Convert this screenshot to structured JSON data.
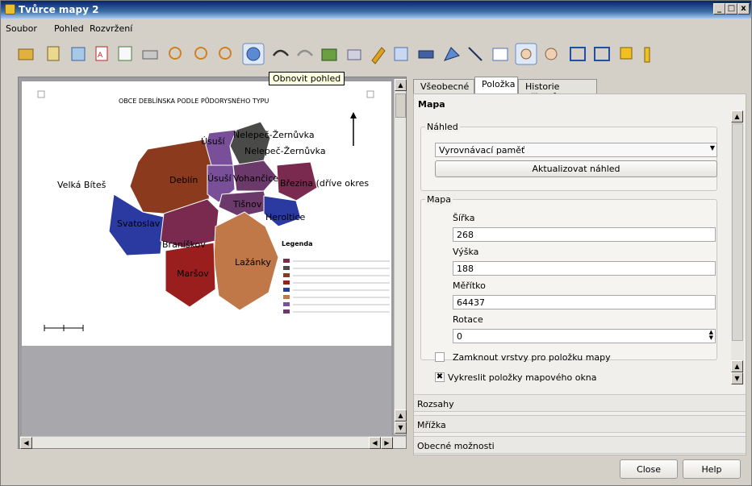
{
  "window": {
    "title": "Tvůrce mapy 2",
    "min_label": "_",
    "max_label": "□",
    "close_label": "x"
  },
  "menu": [
    {
      "label": "Soubor"
    },
    {
      "label": "Pohled"
    },
    {
      "label": "Rozvržení"
    }
  ],
  "toolbar": {
    "icons": [
      "folder-icon",
      "template-icon",
      "export-image-icon",
      "export-pdf-icon",
      "export-svg-icon",
      "print-icon",
      "zoom-full-icon",
      "zoom-in-icon",
      "zoom-out-icon",
      "refresh-view-icon",
      "undo-icon",
      "redo-icon",
      "add-map-icon",
      "add-image-icon",
      "add-label-icon",
      "add-legend-icon",
      "add-scalebar-icon",
      "add-shape-icon",
      "add-arrow-icon",
      "add-table-icon",
      "pan-icon",
      "move-content-icon",
      "group-icon",
      "ungroup-icon",
      "raise-icon",
      "align-icon"
    ],
    "tooltip": "Obnovit pohled"
  },
  "map": {
    "title": "OBCE DEBLÍNSKA PODLE PŮDORYSNÉHO TYPU",
    "regions": [
      {
        "name": "Nelepeč-Žernůvka",
        "color": "#4a4a48"
      },
      {
        "name": "Úsuší",
        "color": "#7a4f9a"
      },
      {
        "name": "Deblín",
        "color": "#8b3a1e"
      },
      {
        "name": "Vohančice",
        "color": "#6b3a6a"
      },
      {
        "name": "Březina (dříve okres",
        "color": "#7a2a4e"
      },
      {
        "name": "Tišnov",
        "color": "#6b3a6a"
      },
      {
        "name": "Heroltice",
        "color": "#2a3aa0"
      },
      {
        "name": "Svatoslav",
        "color": "#2a3aa0"
      },
      {
        "name": "Braníškov",
        "color": "#7a2a4e"
      },
      {
        "name": "Lažánky",
        "color": "#c07848"
      },
      {
        "name": "Maršov",
        "color": "#9a1e1e"
      },
      {
        "name": "Velká Bíteš",
        "color": "#2a3aa0"
      }
    ],
    "legend": {
      "title": "Legenda",
      "items": [
        {
          "color": "#7a2a4e"
        },
        {
          "color": "#4a4a48"
        },
        {
          "color": "#8b3a1e"
        },
        {
          "color": "#9a1e1e"
        },
        {
          "color": "#2a3aa0"
        },
        {
          "color": "#c07848"
        },
        {
          "color": "#7a4f9a"
        },
        {
          "color": "#6b3a6a"
        }
      ]
    }
  },
  "tabs": [
    {
      "label": "Všeobecné"
    },
    {
      "label": "Položka"
    },
    {
      "label": "Historie příkazů"
    }
  ],
  "panel": {
    "section_title": "Mapa",
    "preview": {
      "group_label": "Náhled",
      "mode": "Vyrovnávací paměť",
      "update_button": "Aktualizovat náhled"
    },
    "map_group": {
      "group_label": "Mapa",
      "width_label": "Šířka",
      "width": "268",
      "height_label": "Výška",
      "height": "188",
      "scale_label": "Měřítko",
      "scale": "64437",
      "rotation_label": "Rotace",
      "rotation": "0"
    },
    "lock_layers_label": "Zamknout vrstvy pro položku mapy",
    "draw_items_label": "Vykreslit položky mapového okna",
    "draw_items_checked": "✖",
    "collapsed_sections": [
      {
        "label": "Rozsahy"
      },
      {
        "label": "Mřížka"
      },
      {
        "label": "Obecné možnosti"
      }
    ]
  },
  "footer": {
    "close_button": "Close",
    "help_button": "Help"
  }
}
